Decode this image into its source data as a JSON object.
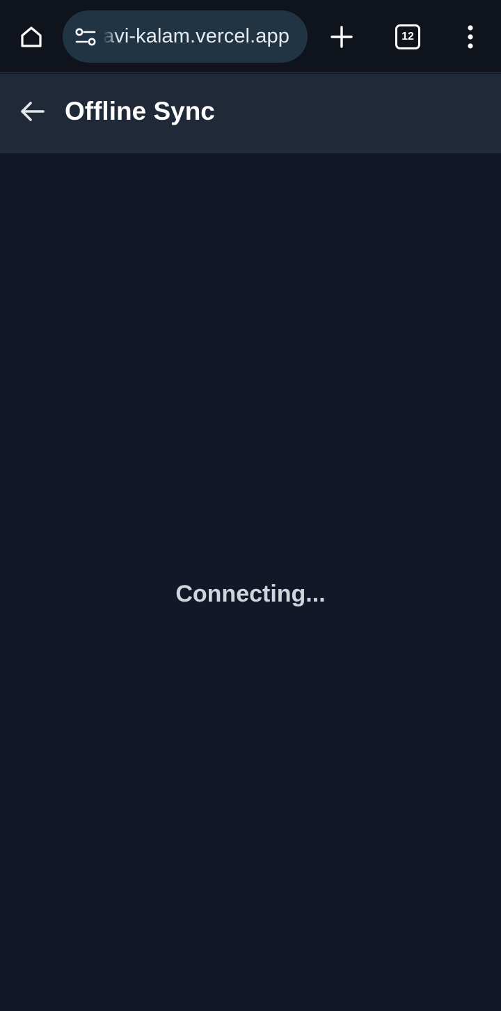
{
  "browser": {
    "url": "avi-kalam.vercel.app",
    "tab_count": "12",
    "icons": {
      "home": "home-icon",
      "site_info": "tune-icon",
      "new_tab": "plus-icon",
      "tabs": "tab-switcher-icon",
      "menu": "more-vert-icon"
    }
  },
  "header": {
    "title": "Offline Sync",
    "back_icon": "arrow-left-icon"
  },
  "main": {
    "status": "Connecting..."
  },
  "colors": {
    "browser_bar_bg": "#0f141c",
    "url_pill_bg": "#213444",
    "header_bg": "#1f2937",
    "page_bg": "#121827",
    "status_text": "#d1d5db",
    "title_text": "#ffffff"
  }
}
